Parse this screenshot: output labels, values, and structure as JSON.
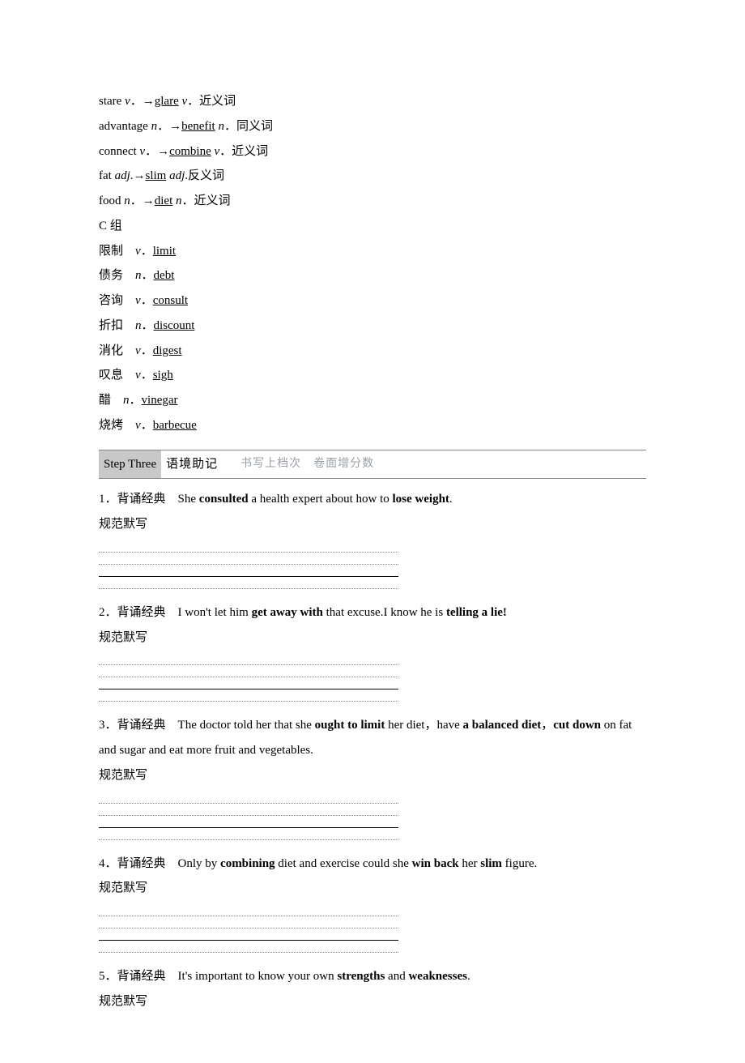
{
  "groupB": {
    "rows": [
      {
        "w1": "stare",
        "pos1": "v",
        "arrow": "．→",
        "w2": "glare",
        "pos2": "v",
        "note": "．近义词"
      },
      {
        "w1": "advantage",
        "pos1": "n",
        "arrow": "．→",
        "w2": "benefit",
        "pos2": "n",
        "note": "．同义词"
      },
      {
        "w1": "connect",
        "pos1": "v",
        "arrow": "．→",
        "w2": "combine",
        "pos2": "v",
        "note": "．近义词"
      },
      {
        "w1": "fat",
        "pos1": "adj",
        "arrow": ".→",
        "w2": "slim",
        "pos2": "adj",
        "note": ".反义词"
      },
      {
        "w1": "food",
        "pos1": "n",
        "arrow": "．→",
        "w2": "diet",
        "pos2": "n",
        "note": "．近义词"
      }
    ]
  },
  "groupC": {
    "heading": "C 组",
    "rows": [
      {
        "zh": "限制",
        "pos": "v",
        "en": "limit"
      },
      {
        "zh": "债务",
        "pos": "n",
        "en": "debt"
      },
      {
        "zh": "咨询",
        "pos": "v",
        "en": "consult"
      },
      {
        "zh": "折扣",
        "pos": "n",
        "en": "discount"
      },
      {
        "zh": "消化",
        "pos": "v",
        "en": "digest"
      },
      {
        "zh": "叹息",
        "pos": "v",
        "en": "sigh"
      },
      {
        "zh": "醋",
        "pos": "n",
        "en": "vinegar"
      },
      {
        "zh": "烧烤",
        "pos": "v",
        "en": "barbecue"
      }
    ]
  },
  "step": {
    "badge": "Step Three",
    "title": "语境助记",
    "subtitle": "书写上档次　卷面增分数"
  },
  "classics": [
    {
      "num": "1．",
      "label": "背诵经典　",
      "parts": [
        {
          "t": "She ",
          "b": false
        },
        {
          "t": "consulted",
          "b": true
        },
        {
          "t": " a health expert about how to ",
          "b": false
        },
        {
          "t": "lose weight",
          "b": true
        },
        {
          "t": ".",
          "b": false
        }
      ],
      "write": "规范默写"
    },
    {
      "num": "2．",
      "label": "背诵经典　",
      "parts": [
        {
          "t": "I won't let him ",
          "b": false
        },
        {
          "t": "get away with",
          "b": true
        },
        {
          "t": " that excuse.I know he is ",
          "b": false
        },
        {
          "t": "telling a lie!",
          "b": true
        }
      ],
      "write": "规范默写"
    },
    {
      "num": "3．",
      "label": "背诵经典　",
      "parts": [
        {
          "t": "The doctor told her that she ",
          "b": false
        },
        {
          "t": "ought to limit",
          "b": true
        },
        {
          "t": " her diet，have ",
          "b": false
        },
        {
          "t": "a balanced diet",
          "b": true
        },
        {
          "t": "，",
          "b": false
        },
        {
          "t": "cut down",
          "b": true
        },
        {
          "t": " on fat and sugar and eat more fruit and vegetables.",
          "b": false
        }
      ],
      "write": "规范默写"
    },
    {
      "num": "4．",
      "label": "背诵经典　",
      "parts": [
        {
          "t": "Only by ",
          "b": false
        },
        {
          "t": "combining",
          "b": true
        },
        {
          "t": " diet and exercise could she ",
          "b": false
        },
        {
          "t": "win back",
          "b": true
        },
        {
          "t": " her ",
          "b": false
        },
        {
          "t": "slim",
          "b": true
        },
        {
          "t": " figure.",
          "b": false
        }
      ],
      "write": "规范默写"
    },
    {
      "num": "5．",
      "label": "背诵经典　",
      "parts": [
        {
          "t": "It's important to know your own ",
          "b": false
        },
        {
          "t": "strengths",
          "b": true
        },
        {
          "t": " and ",
          "b": false
        },
        {
          "t": "weaknesses",
          "b": true
        },
        {
          "t": ".",
          "b": false
        }
      ],
      "write": "规范默写"
    }
  ]
}
